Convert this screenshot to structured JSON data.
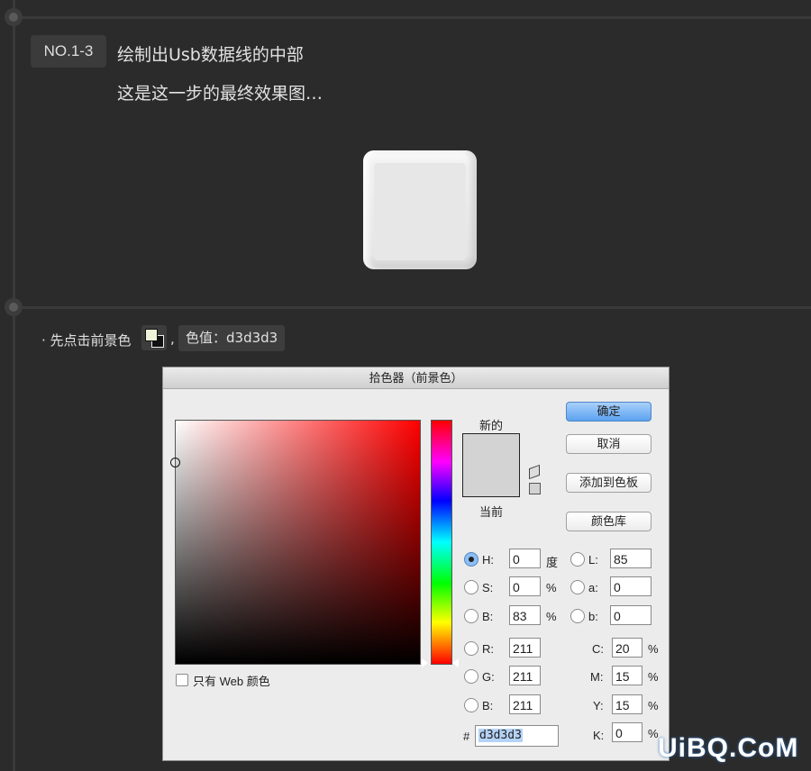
{
  "step": {
    "badge": "NO.1-3",
    "title": "绘制出Usb数据线的中部",
    "subtitle": "这是这一步的最终效果图…"
  },
  "instruction": {
    "text": "· 先点击前景色",
    "comma": ",",
    "color_value": "色值：d3d3d3"
  },
  "dialog": {
    "title": "拾色器（前景色）",
    "only_web": "只有 Web 颜色",
    "new_label": "新的",
    "current_label": "当前",
    "buttons": {
      "ok": "确定",
      "cancel": "取消",
      "add_swatch": "添加到色板",
      "library": "颜色库"
    },
    "hsb": {
      "h": {
        "label": "H:",
        "value": "0",
        "unit": "度"
      },
      "s": {
        "label": "S:",
        "value": "0",
        "unit": "%"
      },
      "b": {
        "label": "B:",
        "value": "83",
        "unit": "%"
      }
    },
    "rgb": {
      "r": {
        "label": "R:",
        "value": "211"
      },
      "g": {
        "label": "G:",
        "value": "211"
      },
      "b": {
        "label": "B:",
        "value": "211"
      }
    },
    "lab": {
      "l": {
        "label": "L:",
        "value": "85"
      },
      "a": {
        "label": "a:",
        "value": "0"
      },
      "b": {
        "label": "b:",
        "value": "0"
      }
    },
    "cmyk": {
      "c": {
        "label": "C:",
        "value": "20",
        "unit": "%"
      },
      "m": {
        "label": "M:",
        "value": "15",
        "unit": "%"
      },
      "y": {
        "label": "Y:",
        "value": "15",
        "unit": "%"
      },
      "k": {
        "label": "K:",
        "value": "0",
        "unit": "%"
      }
    },
    "hex": {
      "label": "#",
      "value": "d3d3d3"
    },
    "preview_color": "#d3d3d3"
  },
  "watermark": "UiBQ.CoM"
}
